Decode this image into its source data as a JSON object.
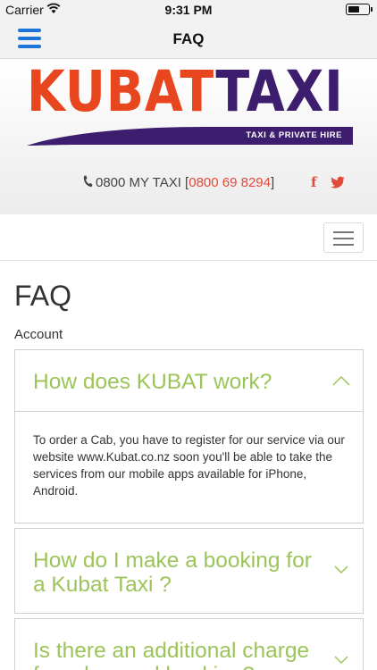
{
  "status_bar": {
    "carrier": "Carrier",
    "time": "9:31 PM",
    "battery_level": 0.6
  },
  "nav": {
    "title": "FAQ",
    "menu_icon": "hamburger-icon"
  },
  "header": {
    "logo_word1": "KUBAT",
    "logo_word2": "TAXI",
    "logo_tagline": "TAXI & PRIVATE HIRE",
    "phone_label": "0800 MY TAXI [",
    "phone_number": "0800 69 8294",
    "phone_suffix": "]",
    "social": {
      "facebook": "f",
      "twitter_icon": "twitter-icon"
    },
    "colors": {
      "brand_orange": "#e8461f",
      "brand_purple": "#3d1d6d",
      "accent_red": "#e24a3b"
    }
  },
  "menu": {
    "toggle_icon": "menu-toggle-icon"
  },
  "content": {
    "heading": "FAQ",
    "section": "Account",
    "accent_green": "#9cc45a",
    "faqs": [
      {
        "question": "How does KUBAT work?",
        "answer": "To order a Cab, you have to register for our service via our website www.Kubat.co.nz soon you'll be able to take the services from our mobile apps available for iPhone, Android.",
        "expanded": true
      },
      {
        "question": "How do I make a booking for a Kubat Taxi ?",
        "expanded": false
      },
      {
        "question": "Is there an additional charge for advanced booking?",
        "expanded": false
      }
    ]
  }
}
